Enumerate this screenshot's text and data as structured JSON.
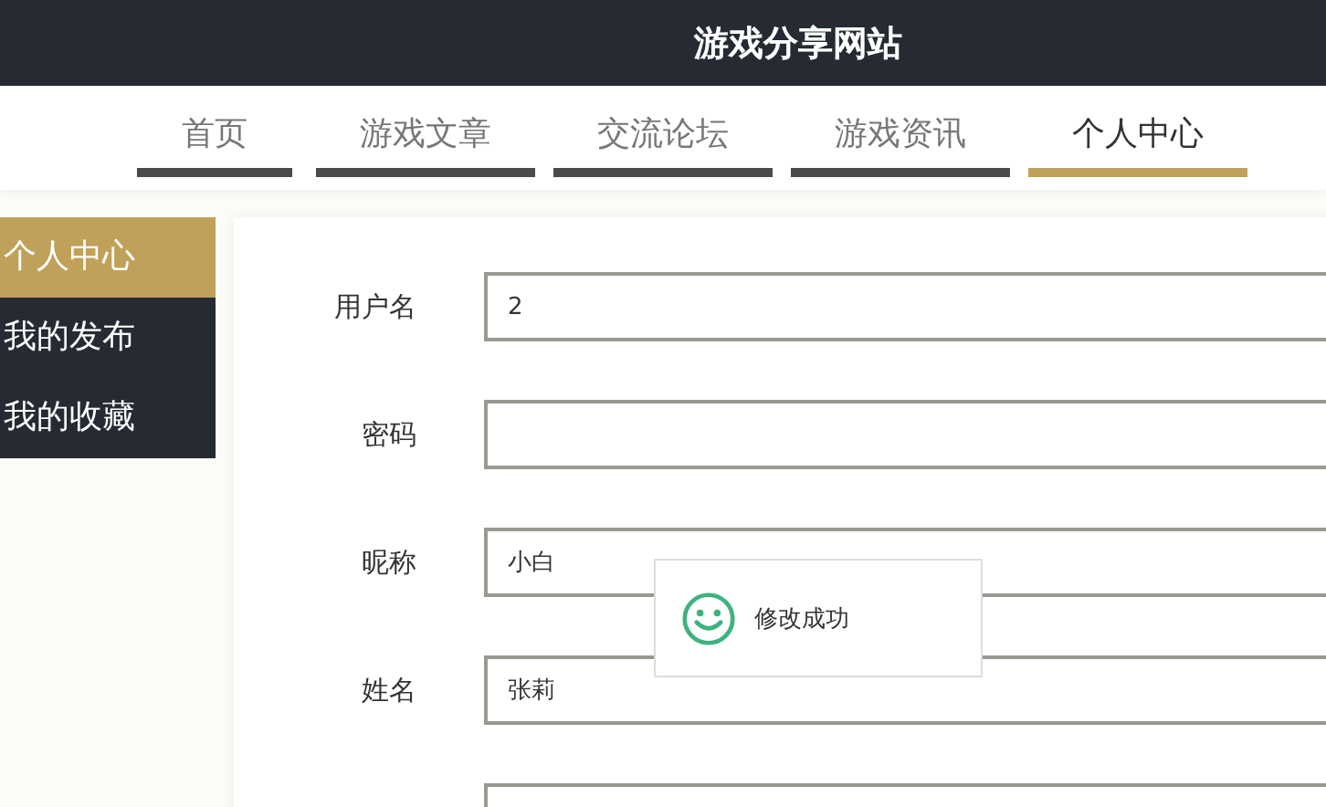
{
  "header": {
    "title": "游戏分享网站"
  },
  "nav": [
    {
      "label": "首页",
      "selected": false
    },
    {
      "label": "游戏文章",
      "selected": false
    },
    {
      "label": "交流论坛",
      "selected": false
    },
    {
      "label": "游戏资讯",
      "selected": false
    },
    {
      "label": "个人中心",
      "selected": true
    }
  ],
  "sidebar": {
    "items": [
      {
        "label": "个人中心",
        "selected": true
      },
      {
        "label": "我的发布",
        "selected": false
      },
      {
        "label": "我的收藏",
        "selected": false
      }
    ]
  },
  "form": {
    "fields": [
      {
        "kind": "text",
        "label": "用户名",
        "value": "2"
      },
      {
        "kind": "text",
        "label": "密码"
      },
      {
        "kind": "text",
        "label": "昵称",
        "value": "小白"
      },
      {
        "kind": "text",
        "label": "姓名",
        "value": "张莉"
      },
      {
        "kind": "text"
      }
    ]
  },
  "toast": {
    "message": "修改成功"
  }
}
